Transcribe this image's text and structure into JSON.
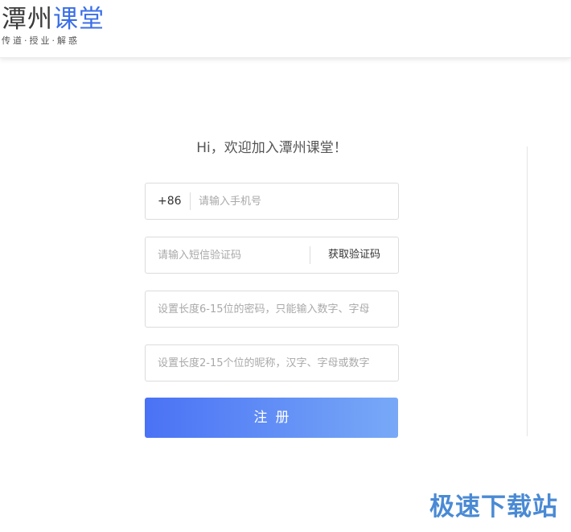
{
  "header": {
    "logo_part1": "潭州",
    "logo_part2": "课堂",
    "slogan": "传道·授业·解惑"
  },
  "form": {
    "title": "Hi，欢迎加入潭州课堂！",
    "phone_prefix": "+86",
    "phone_placeholder": "请输入手机号",
    "sms_placeholder": "请输入短信验证码",
    "sms_button": "获取验证码",
    "password_placeholder": "设置长度6-15位的密码，只能输入数字、字母",
    "nickname_placeholder": "设置长度2-15个位的昵称，汉字、字母或数字",
    "register_button": "注册"
  },
  "watermark": "极速下载站",
  "colors": {
    "brand_blue": "#3a6ee8",
    "button_gradient_start": "#4a72f5",
    "button_gradient_end": "#78a9f7",
    "watermark": "#4a8ad4"
  }
}
